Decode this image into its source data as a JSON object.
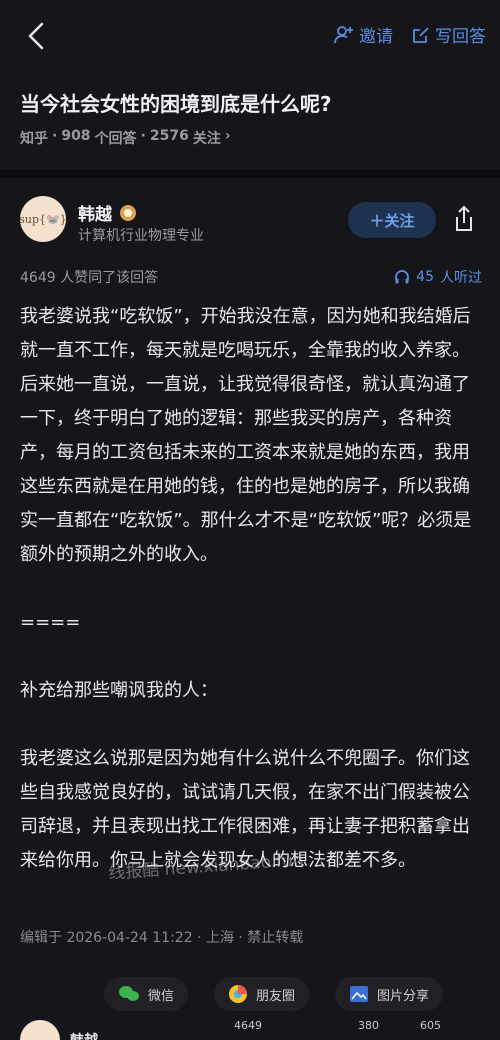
{
  "topbar": {
    "invite_label": "邀请",
    "write_answer_label": "写回答"
  },
  "question": {
    "title": "当今社会女性的困境到底是什么呢?",
    "source": "知乎",
    "answers_count": "908",
    "answers_label": "个回答",
    "followers_count": "2576",
    "followers_label": "关注",
    "sep": "·",
    "chevron": "›"
  },
  "author": {
    "avatar_text": "sup{🐭}",
    "name": "韩越",
    "description": "计算机行业物理专业",
    "follow_label": "＋关注"
  },
  "stats": {
    "likes_text": "4649  人赞同了该回答",
    "listen_count": "45",
    "listen_label": "人听过"
  },
  "content": {
    "paragraphs": [
      "我老婆说我“吃软饭”，开始我没在意，因为她和我结婚后就一直不工作，每天就是吃喝玩乐，全靠我的收入养家。后来她一直说，一直说，让我觉得很奇怪，就认真沟通了一下，终于明白了她的逻辑：那些我买的房产，各种资产，每月的工资包括未来的工资本来就是她的东西，我用这些东西就是在用她的钱，住的也是她的房子，所以我确实一直都在“吃软饭”。那什么才不是“吃软饭”呢？必须是额外的预期之外的收入。",
      "====",
      "补充给那些嘲讽我的人：",
      "我老婆这么说那是因为她有什么说什么不兜圈子。你们这些自我感觉良好的，试试请几天假，在家不出门假装被公司辞退，并且表现出找工作很困难，再让妻子把积蓄拿出来给你用。你马上就会发现女人的想法都差不多。"
    ]
  },
  "meta": {
    "text": "编辑于  2026-04-24  11:22 · 上海 · 禁止转载"
  },
  "share": {
    "wechat": "微信",
    "moments": "朋友圈",
    "image_share": "图片分享"
  },
  "bottom": {
    "name": "韩越",
    "likes": "4649",
    "comments": "380",
    "favorites": "605"
  },
  "watermark": "线报酷 new.xianbao.fun",
  "colors": {
    "background": "#15151a",
    "accent": "#5a8ee0",
    "follow_bg": "#1f3350"
  }
}
